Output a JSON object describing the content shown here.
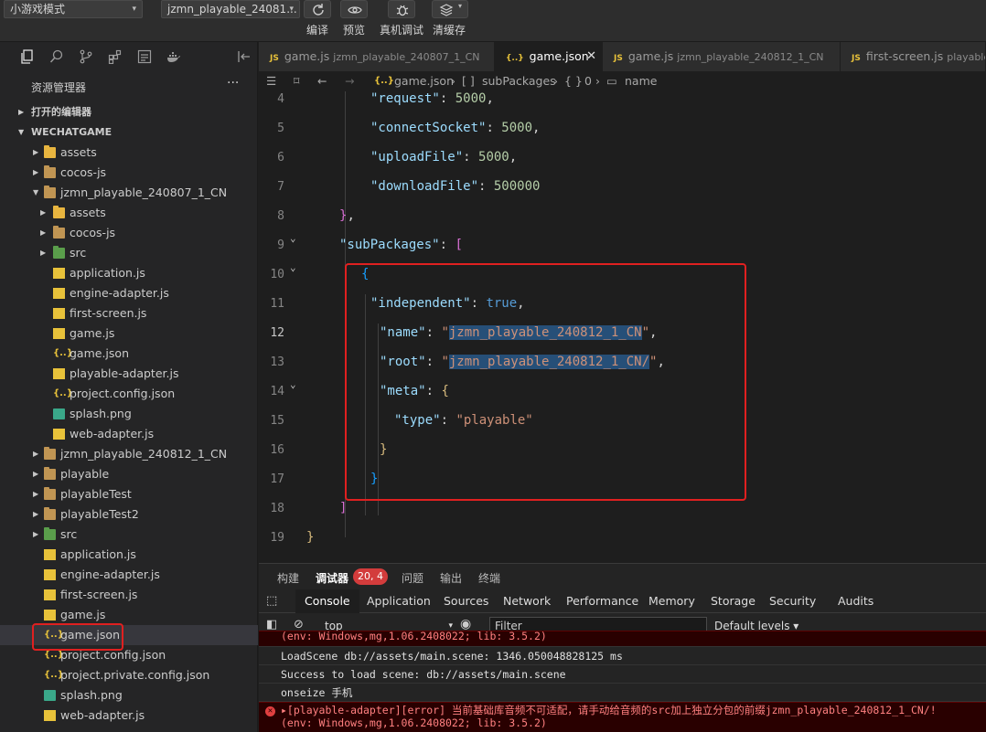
{
  "toolbar": {
    "mode_select": "小游戏模式",
    "project_select": "jzmn_playable_24081...",
    "buttons": [
      {
        "label": "编译",
        "icon": "refresh-icon"
      },
      {
        "label": "预览",
        "icon": "eye-icon"
      },
      {
        "label": "真机调试",
        "icon": "bug-icon"
      },
      {
        "label": "清缓存",
        "icon": "layers-icon"
      }
    ]
  },
  "sidebar": {
    "title": "资源管理器",
    "more": "···",
    "open_editors": "打开的编辑器",
    "root": "WECHATGAME",
    "items": [
      {
        "label": "assets",
        "type": "folder"
      },
      {
        "label": "cocos-js",
        "type": "folder"
      },
      {
        "label": "jzmn_playable_240807_1_CN",
        "type": "folder"
      },
      {
        "label": "assets",
        "type": "folder"
      },
      {
        "label": "cocos-js",
        "type": "folder"
      },
      {
        "label": "src",
        "type": "folder"
      },
      {
        "label": "application.js",
        "type": "js"
      },
      {
        "label": "engine-adapter.js",
        "type": "js"
      },
      {
        "label": "first-screen.js",
        "type": "js"
      },
      {
        "label": "game.js",
        "type": "js"
      },
      {
        "label": "game.json",
        "type": "json"
      },
      {
        "label": "playable-adapter.js",
        "type": "js"
      },
      {
        "label": "project.config.json",
        "type": "json"
      },
      {
        "label": "splash.png",
        "type": "png"
      },
      {
        "label": "web-adapter.js",
        "type": "js"
      },
      {
        "label": "jzmn_playable_240812_1_CN",
        "type": "folder"
      },
      {
        "label": "playable",
        "type": "folder"
      },
      {
        "label": "playableTest",
        "type": "folder"
      },
      {
        "label": "playableTest2",
        "type": "folder"
      },
      {
        "label": "src",
        "type": "folder"
      },
      {
        "label": "application.js",
        "type": "js"
      },
      {
        "label": "engine-adapter.js",
        "type": "js"
      },
      {
        "label": "first-screen.js",
        "type": "js"
      },
      {
        "label": "game.js",
        "type": "js"
      },
      {
        "label": "game.json",
        "type": "json"
      },
      {
        "label": "project.config.json",
        "type": "json"
      },
      {
        "label": "project.private.config.json",
        "type": "json"
      },
      {
        "label": "splash.png",
        "type": "png"
      },
      {
        "label": "web-adapter.js",
        "type": "js"
      }
    ]
  },
  "editor": {
    "tabs": [
      {
        "name": "game.js",
        "desc": "jzmn_playable_240807_1_CN",
        "icon": "JS"
      },
      {
        "name": "game.json",
        "desc": "",
        "icon": "{..}",
        "close": "✕"
      },
      {
        "name": "game.js",
        "desc": "jzmn_playable_240812_1_CN",
        "icon": "JS"
      },
      {
        "name": "first-screen.js",
        "desc": "playableT",
        "icon": "JS"
      }
    ],
    "breadcrumbs": [
      "game.json",
      "subPackages",
      "0",
      "name"
    ],
    "line_numbers": [
      "4",
      "5",
      "6",
      "7",
      "8",
      "9",
      "10",
      "11",
      "12",
      "13",
      "14",
      "15",
      "16",
      "17",
      "18",
      "19"
    ],
    "code": {
      "k_request": "\"request\"",
      "v_request": "5000",
      "k_connect": "\"connectSocket\"",
      "v_connect": "5000",
      "k_upload": "\"uploadFile\"",
      "v_upload": "5000",
      "k_download": "\"downloadFile\"",
      "v_download": "500000",
      "k_subpackages": "\"subPackages\"",
      "k_independent": "\"independent\"",
      "v_independent": "true",
      "k_name": "\"name\"",
      "v_name": "jzmn_playable_240812_1_CN",
      "k_root": "\"root\"",
      "v_root": "jzmn_playable_240812_1_CN/",
      "k_meta": "\"meta\"",
      "k_type": "\"type\"",
      "v_type": "\"playable\""
    }
  },
  "panel": {
    "tabs": [
      "构建",
      "调试器",
      "问题",
      "输出",
      "终端"
    ],
    "badge": "20, 4",
    "devtools_tabs": [
      "Console",
      "Application",
      "Sources",
      "Network",
      "Performance",
      "Memory",
      "Storage",
      "Security",
      "Audits"
    ],
    "context": "top",
    "filter_placeholder": "Filter",
    "levels": "Default levels ▾",
    "logs": [
      {
        "text": "(env: Windows,mg,1.06.2408022; lib: 3.5.2)",
        "level": "error-cut"
      },
      {
        "text": "LoadScene db://assets/main.scene: 1346.050048828125 ms",
        "level": "info"
      },
      {
        "text": "Success to load scene: db://assets/main.scene",
        "level": "info"
      },
      {
        "text": "onseize 手机",
        "level": "info"
      },
      {
        "text": "▸[playable-adapter][error] 当前基础库音频不可适配，请手动给音频的src加上独立分包的前缀jzmn_playable_240812_1_CN/!",
        "level": "error"
      },
      {
        "text": "(env: Windows,mg,1.06.2408022; lib: 3.5.2)",
        "level": "error"
      }
    ]
  }
}
